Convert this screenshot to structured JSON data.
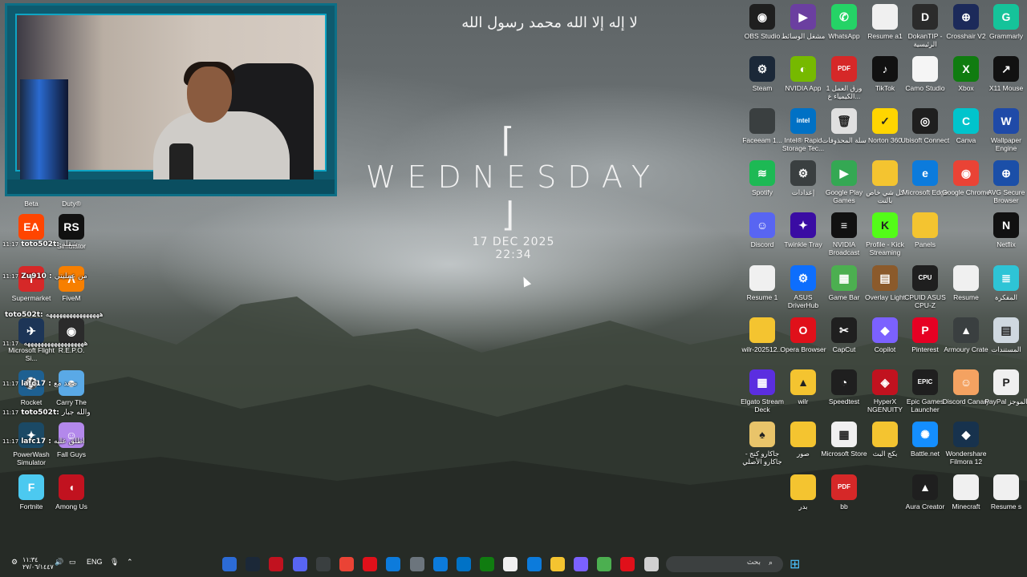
{
  "wallpaper_widget": {
    "shahada": "لا إله إلا الله محمد رسول الله",
    "day": "WEDNESDAY",
    "bracket_left": "⌈",
    "bracket_right": "⌋",
    "date": "17 DEC 2025",
    "time": "22:34"
  },
  "left_icons": [
    {
      "id": "beta",
      "label": "Beta",
      "color": "#2a2a2a",
      "glyph": ""
    },
    {
      "id": "duty",
      "label": "Duty®",
      "color": "#2a2a2a",
      "glyph": ""
    },
    {
      "id": "ea",
      "label": "",
      "color": "#ff4500",
      "glyph": "EA"
    },
    {
      "id": "simulator",
      "label": "Simulator",
      "color": "#111111",
      "glyph": "RS"
    },
    {
      "id": "supermarket",
      "label": "Supermarket",
      "color": "#d62828",
      "glyph": "T"
    },
    {
      "id": "fivem",
      "label": "FiveM",
      "color": "#f77f00",
      "glyph": "Λ"
    },
    {
      "id": "flight-sim",
      "label": "Microsoft Flight Si...",
      "color": "#1d3557",
      "glyph": "✈"
    },
    {
      "id": "repo",
      "label": "R.E.P.O.",
      "color": "#2b2b2b",
      "glyph": "◉"
    },
    {
      "id": "rocket",
      "label": "Rocket",
      "color": "#1e6091",
      "glyph": "⚽"
    },
    {
      "id": "carry",
      "label": "Carry The",
      "color": "#5aa9e6",
      "glyph": "☻"
    },
    {
      "id": "powerwash",
      "label": "PowerWash Simulator",
      "color": "#1b4965",
      "glyph": "✦"
    },
    {
      "id": "fallguys",
      "label": "Fall Guys",
      "color": "#b388eb",
      "glyph": "☺"
    },
    {
      "id": "fortnite",
      "label": "Fortnite",
      "color": "#4cc9f0",
      "glyph": "F"
    },
    {
      "id": "amongus",
      "label": "Among Us",
      "color": "#c1121f",
      "glyph": "◖"
    }
  ],
  "right_icons": [
    {
      "id": "obs",
      "label": "OBS Studio",
      "color": "#1f1f1f",
      "glyph": "◉"
    },
    {
      "id": "media",
      "label": "مشغل الوسائط",
      "color": "#6b3fa0",
      "glyph": "▶"
    },
    {
      "id": "whatsapp",
      "label": "WhatsApp",
      "color": "#25d366",
      "glyph": "✆"
    },
    {
      "id": "resume-a1",
      "label": "Resume a1",
      "color": "#f0f0f0",
      "glyph": ""
    },
    {
      "id": "dokantip",
      "label": "DokanTIP - الرئيسية",
      "color": "#2b2b2b",
      "glyph": "D"
    },
    {
      "id": "crosshair",
      "label": "Crosshair V2",
      "color": "#1c2a5a",
      "glyph": "⊕"
    },
    {
      "id": "grammarly",
      "label": "Grammarly",
      "color": "#15c39a",
      "glyph": "G"
    },
    {
      "id": "steam",
      "label": "Steam",
      "color": "#1b2838",
      "glyph": "⚙"
    },
    {
      "id": "nvidia",
      "label": "NVIDIA App",
      "color": "#76b900",
      "glyph": "◐"
    },
    {
      "id": "pdf-chem",
      "label": "ورق العمل 1 الكيمياء ع...",
      "color": "#d62828",
      "glyph": "PDF"
    },
    {
      "id": "tiktok",
      "label": "TikTok",
      "color": "#111111",
      "glyph": "♪"
    },
    {
      "id": "camo",
      "label": "Camo Studio",
      "color": "#f5f5f5",
      "glyph": ""
    },
    {
      "id": "xbox",
      "label": "Xbox",
      "color": "#107c10",
      "glyph": "X"
    },
    {
      "id": "x11",
      "label": "X11 Mouse",
      "color": "#111111",
      "glyph": "↗"
    },
    {
      "id": "faceeam",
      "label": "Faceeam 1...",
      "color": "#3a3f40",
      "glyph": ""
    },
    {
      "id": "intel",
      "label": "Intel® Rapid Storage Tec...",
      "color": "#0071c5",
      "glyph": "intel"
    },
    {
      "id": "recycle",
      "label": "سلة المحذوفات",
      "color": "#e0e0e0",
      "glyph": "🗑"
    },
    {
      "id": "norton",
      "label": "Norton 360",
      "color": "#ffd500",
      "glyph": "✓"
    },
    {
      "id": "ubisoft",
      "label": "Ubisoft Connect",
      "color": "#1f1f1f",
      "glyph": "◎"
    },
    {
      "id": "canva",
      "label": "Canva",
      "color": "#00c4cc",
      "glyph": "C"
    },
    {
      "id": "wallpaper",
      "label": "Wallpaper Engine",
      "color": "#1f4aa8",
      "glyph": "W"
    },
    {
      "id": "spotify",
      "label": "Spotify",
      "color": "#1db954",
      "glyph": "≋"
    },
    {
      "id": "settings",
      "label": "إعدادات",
      "color": "#3a3f40",
      "glyph": "⚙"
    },
    {
      "id": "gplay",
      "label": "Google Play Games",
      "color": "#34a853",
      "glyph": "▶"
    },
    {
      "id": "folder-all",
      "label": "كل شي خاص بالنت",
      "color": "#f4c430",
      "glyph": ""
    },
    {
      "id": "edge",
      "label": "Microsoft Edge",
      "color": "#0c7bdc",
      "glyph": "e"
    },
    {
      "id": "chrome",
      "label": "Google Chrome",
      "color": "#ea4335",
      "glyph": "◉"
    },
    {
      "id": "avg",
      "label": "AVG Secure Browser",
      "color": "#1b4fa8",
      "glyph": "⊕"
    },
    {
      "id": "discord",
      "label": "Discord",
      "color": "#5865f2",
      "glyph": "☺"
    },
    {
      "id": "twinkle",
      "label": "Twinkle Tray",
      "color": "#3a0ca3",
      "glyph": "✦"
    },
    {
      "id": "nvdia-broadcast",
      "label": "NVIDIA Broadcast",
      "color": "#111111",
      "glyph": "≡"
    },
    {
      "id": "kick",
      "label": "Profile - Kick Streaming",
      "color": "#53fc18",
      "glyph": "K"
    },
    {
      "id": "panels",
      "label": "Panels",
      "color": "#f4c430",
      "glyph": ""
    },
    {
      "id": "netflix",
      "label": "Netflix",
      "color": "#111111",
      "glyph": "N"
    },
    {
      "id": "resume1",
      "label": "Resume 1",
      "color": "#f0f0f0",
      "glyph": ""
    },
    {
      "id": "asus",
      "label": "ASUS DriverHub",
      "color": "#0d6efd",
      "glyph": "⚙"
    },
    {
      "id": "gamebar",
      "label": "Game Bar",
      "color": "#4caf50",
      "glyph": "▦"
    },
    {
      "id": "overlay",
      "label": "Overlay Light",
      "color": "#8b5a2b",
      "glyph": "▤"
    },
    {
      "id": "cpuid",
      "label": "CPUID ASUS CPU-Z",
      "color": "#1f1f1f",
      "glyph": "CPU"
    },
    {
      "id": "resume",
      "label": "Resume",
      "color": "#f0f0f0",
      "glyph": ""
    },
    {
      "id": "notebook",
      "label": "المفكرة",
      "color": "#2ec4d6",
      "glyph": "≣"
    },
    {
      "id": "wilr-folder",
      "label": "wilr-202512...",
      "color": "#f4c430",
      "glyph": ""
    },
    {
      "id": "opera",
      "label": "Opera Browser",
      "color": "#e0101a",
      "glyph": "O"
    },
    {
      "id": "capcut",
      "label": "CapCut",
      "color": "#1f1f1f",
      "glyph": "✂"
    },
    {
      "id": "copilot",
      "label": "Copilot",
      "color": "#7b61ff",
      "glyph": "◆"
    },
    {
      "id": "pinterest",
      "label": "Pinterest",
      "color": "#e60023",
      "glyph": "P"
    },
    {
      "id": "armoury",
      "label": "Armoury Crate",
      "color": "#3a3f40",
      "glyph": "▲"
    },
    {
      "id": "docs",
      "label": "المستندات",
      "color": "#cfd8e0",
      "glyph": "▤"
    },
    {
      "id": "elgato",
      "label": "Elgato Stream Deck",
      "color": "#5b2ee0",
      "glyph": "▦"
    },
    {
      "id": "wilr",
      "label": "wilr",
      "color": "#f4c430",
      "glyph": "▲"
    },
    {
      "id": "speedtest",
      "label": "Speedtest",
      "color": "#1f1f1f",
      "glyph": "◔"
    },
    {
      "id": "hyperx",
      "label": "HyperX NGENUITY",
      "color": "#c1121f",
      "glyph": "◈"
    },
    {
      "id": "epic",
      "label": "Epic Games Launcher",
      "color": "#1f1f1f",
      "glyph": "EPIC"
    },
    {
      "id": "discord-canary",
      "label": "Discord Canary",
      "color": "#f4a261",
      "glyph": "☺"
    },
    {
      "id": "paypal",
      "label": "PayPal الموجز",
      "color": "#f0f0f0",
      "glyph": "P"
    },
    {
      "id": "jakaro",
      "label": "جاكارو كنج - جاكارو الأصلي",
      "color": "#e9c46a",
      "glyph": "♠"
    },
    {
      "id": "pics",
      "label": "صور",
      "color": "#f4c430",
      "glyph": ""
    },
    {
      "id": "store",
      "label": "Microsoft Store",
      "color": "#f0f0f0",
      "glyph": "▦"
    },
    {
      "id": "bakk",
      "label": "بكج البث",
      "color": "#f4c430",
      "glyph": ""
    },
    {
      "id": "battlenet",
      "label": "Battle.net",
      "color": "#148eff",
      "glyph": "✺"
    },
    {
      "id": "filmora",
      "label": "Wondershare Filmora 12",
      "color": "#17324d",
      "glyph": "◆"
    },
    {
      "id": "badr",
      "label": "بدر",
      "color": "#f4c430",
      "glyph": ""
    },
    {
      "id": "bb",
      "label": "bb",
      "color": "#d62828",
      "glyph": "PDF"
    },
    {
      "id": "aura",
      "label": "Aura Creator",
      "color": "#1f1f1f",
      "glyph": "▲"
    },
    {
      "id": "minecraft",
      "label": "Minecraft",
      "color": "#f0f0f0",
      "glyph": ""
    },
    {
      "id": "resumes",
      "label": "Resume s",
      "color": "#f0f0f0",
      "glyph": ""
    }
  ],
  "chat": [
    {
      "time": "11:17",
      "user": "toto502t:",
      "text": "شقلة"
    },
    {
      "time": "11:17",
      "user": "Zu910 :",
      "text": "من عمليتي"
    },
    {
      "time": "",
      "user": "toto502t:",
      "text": "ههههههههههههههههه"
    },
    {
      "time": "11:17",
      "user": "",
      "text": "ههههههههههههههههههه"
    },
    {
      "time": "11:17",
      "user": "lafc17 :",
      "text": "صعد مع"
    },
    {
      "time": "11:17",
      "user": "toto502t:",
      "text": "والله جبار"
    },
    {
      "time": "11:17",
      "user": "lafc17 :",
      "text": "أطلق عليه"
    }
  ],
  "taskbar": {
    "search_placeholder": "بحث",
    "language": "ENG",
    "clock_time": "١١:٣٤",
    "clock_date": "٢٧/٠٦/١٤٤٧"
  }
}
